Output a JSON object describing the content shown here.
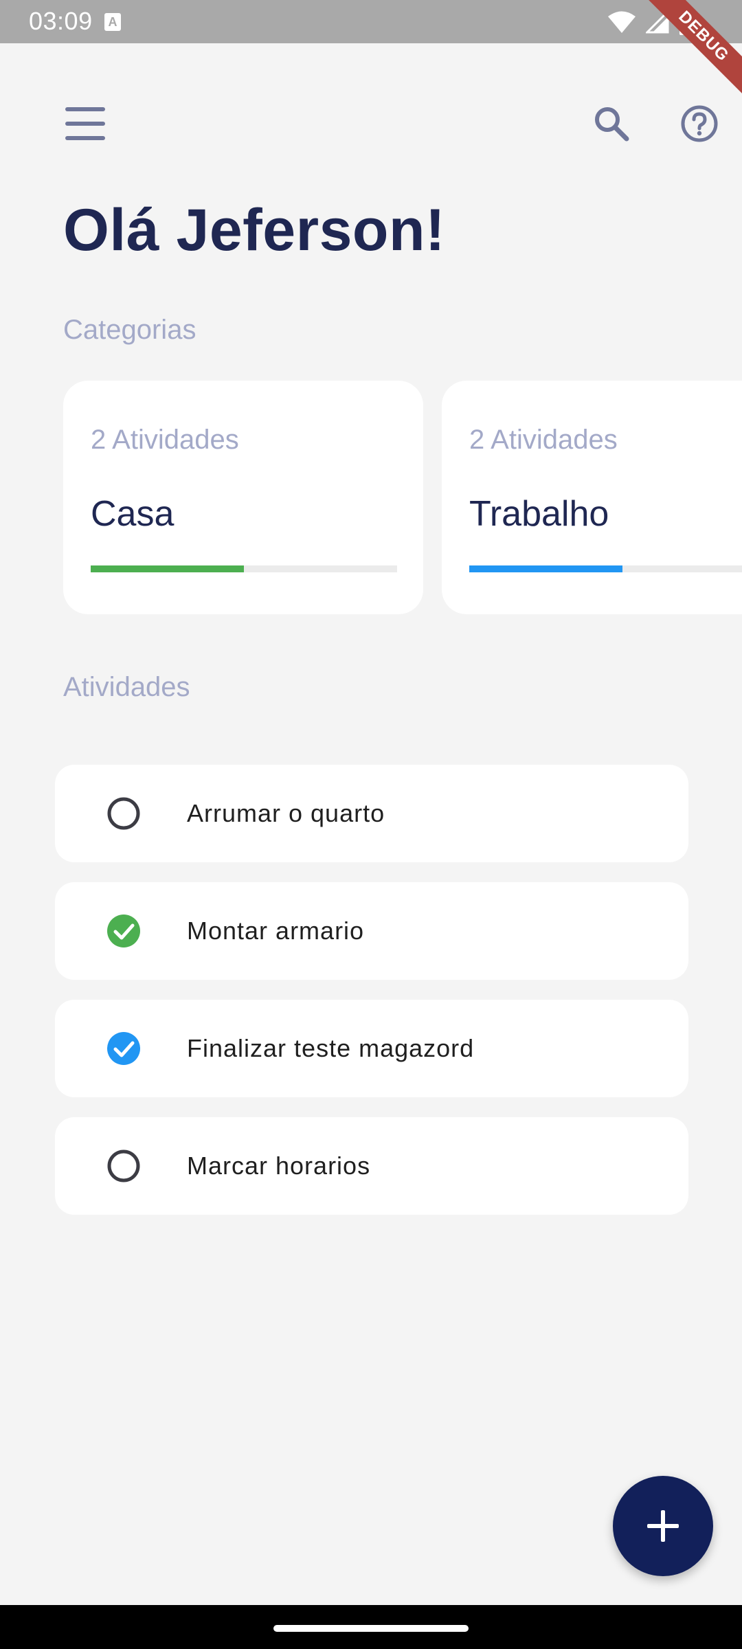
{
  "status_bar": {
    "time": "03:09",
    "debug_label": "DEBUG",
    "a_icon_letter": "A"
  },
  "header": {
    "greeting": "Olá Jeferson!"
  },
  "categories_section": {
    "label": "Categorias",
    "items": [
      {
        "count": "2 Atividades",
        "name": "Casa",
        "progress": 0.5,
        "color": "#4caf50"
      },
      {
        "count": "2 Atividades",
        "name": "Trabalho",
        "progress": 0.5,
        "color": "#2196f3"
      }
    ]
  },
  "activities_section": {
    "label": "Atividades",
    "items": [
      {
        "title": "Arrumar o quarto",
        "done": false
      },
      {
        "title": "Montar armario",
        "done": true,
        "check_color": "#4caf50"
      },
      {
        "title": "Finalizar teste magazord",
        "done": true,
        "check_color": "#2196f3"
      },
      {
        "title": "Marcar horarios",
        "done": false
      }
    ]
  },
  "icons": {
    "menu": "menu-icon",
    "search": "search-icon",
    "help": "help-icon",
    "add": "add-icon"
  },
  "colors": {
    "primary_dark": "#1f2752",
    "muted": "#a3a9c8",
    "fab": "#12205a",
    "background": "#f4f4f4"
  }
}
